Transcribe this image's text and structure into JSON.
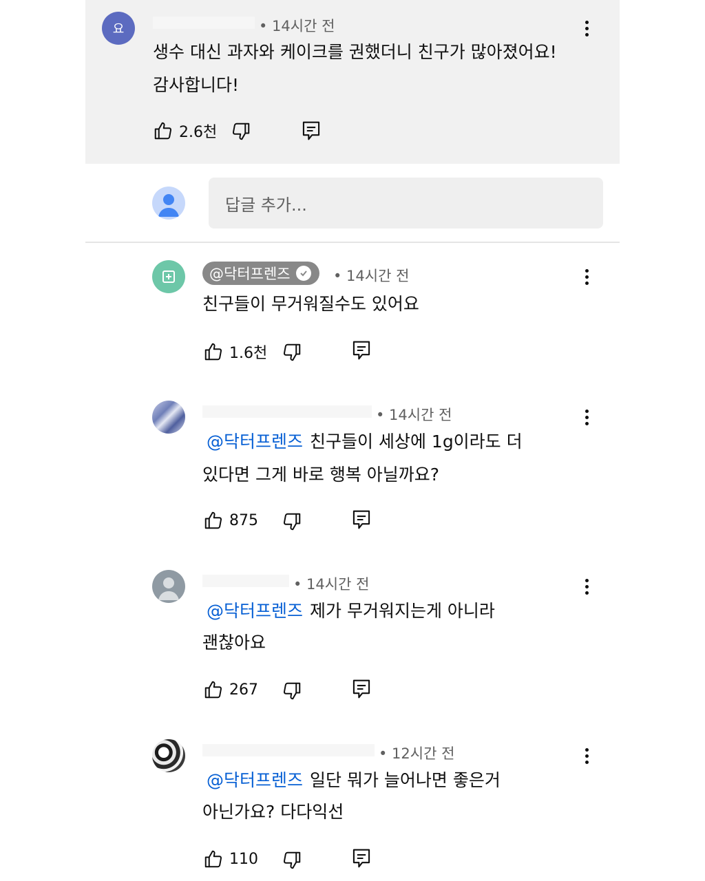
{
  "top_comment": {
    "avatar_letter": "요",
    "time": "• 14시간 전",
    "text_line1": "생수 대신 과자와 케이크를 권했더니 친구가 많아졌어요!",
    "text_line2": "감사합니다!",
    "likes": "2.6천"
  },
  "reply_input": {
    "placeholder": "답글 추가..."
  },
  "replies": [
    {
      "channel": "@닥터프렌즈",
      "time": "• 14시간 전",
      "text_line1": "친구들이 무거워질수도 있어요",
      "likes": "1.6천"
    },
    {
      "time": "• 14시간 전",
      "mention": "@닥터프렌즈",
      "text_line1": "친구들이 세상에 1g이라도 더",
      "text_line2": "있다면 그게 바로 행복 아닐까요?",
      "likes": "875"
    },
    {
      "time": "• 14시간 전",
      "mention": "@닥터프렌즈",
      "text_line1": "제가 무거워지는게 아니라",
      "text_line2": "괜찮아요",
      "likes": "267"
    },
    {
      "time": "• 12시간 전",
      "mention": "@닥터프렌즈",
      "text_line1": "일단 뭐가 늘어나면 좋은거",
      "text_line2": "아닌가요? 다다익선",
      "likes": "110"
    }
  ],
  "icons": {
    "like": "thumbs-up-icon",
    "dislike": "thumbs-down-icon",
    "reply": "reply-icon",
    "more": "more-vert-icon"
  },
  "colors": {
    "top_comment_bg": "#f1f1f1",
    "mention": "#065fd4",
    "channel_badge": "#888888",
    "channel_avatar": "#6dc7a8",
    "top_avatar": "#5c6bc0"
  }
}
